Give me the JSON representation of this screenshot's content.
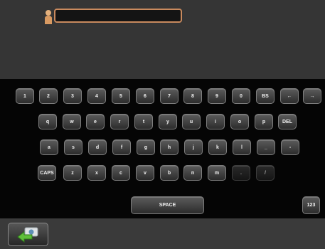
{
  "user_field": {
    "value": ""
  },
  "keyboard": {
    "row1": [
      "1",
      "2",
      "3",
      "4",
      "5",
      "6",
      "7",
      "8",
      "9",
      "0",
      "BS",
      "←",
      "→"
    ],
    "row2": [
      "q",
      "w",
      "e",
      "r",
      "t",
      "y",
      "u",
      "i",
      "o",
      "p",
      "DEL"
    ],
    "row3": [
      "a",
      "s",
      "d",
      "f",
      "g",
      "h",
      "j",
      "k",
      "l",
      "_",
      "-"
    ],
    "row4": [
      "CAPS",
      "z",
      "x",
      "c",
      "v",
      "b",
      "n",
      "m",
      ".",
      "/"
    ],
    "space_label": "SPACE",
    "mode_label": "123"
  },
  "colors": {
    "field_border": "#c98a5e",
    "key_face": "#4a4a4a",
    "back_arrow": "#5fbf3a"
  },
  "icons": {
    "user": "user-icon",
    "back": "back-arrow-icon"
  }
}
